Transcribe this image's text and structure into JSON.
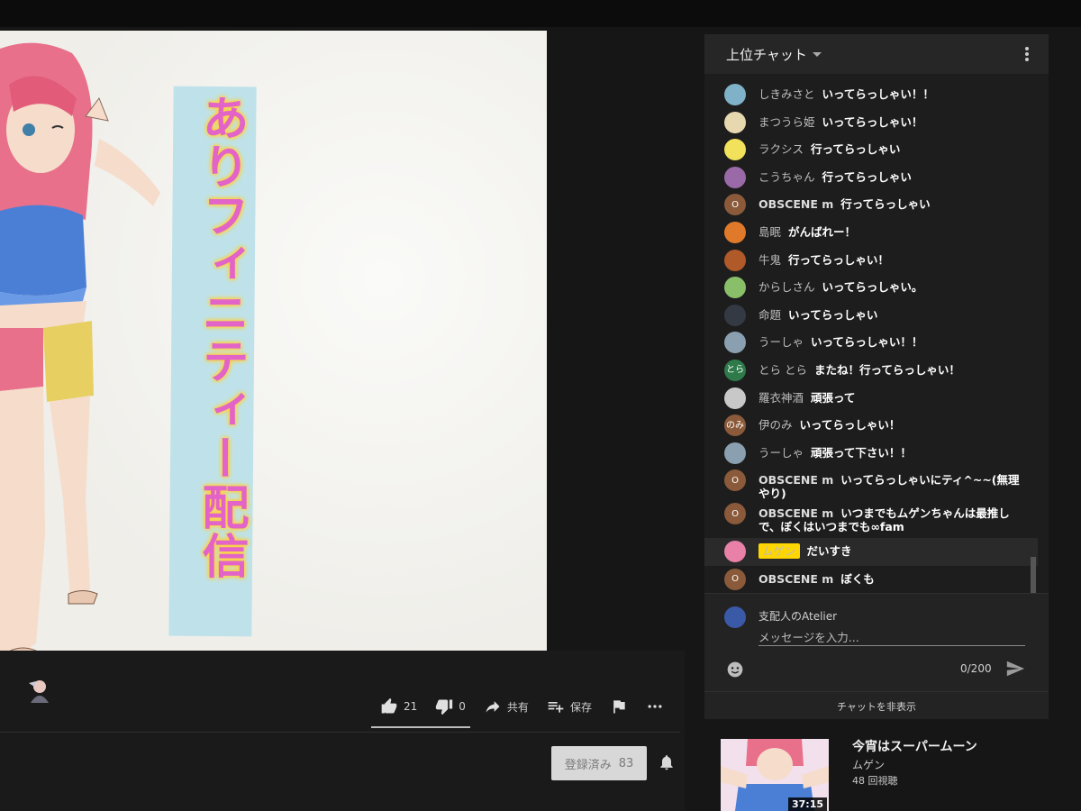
{
  "video": {
    "banner_text": "ありフィニティー配信"
  },
  "actions": {
    "like_count": "21",
    "dislike_count": "0",
    "share_label": "共有",
    "save_label": "保存"
  },
  "subscribe": {
    "label": "登録済み",
    "count": "83"
  },
  "chat": {
    "header_title": "上位チャット",
    "messages": [
      {
        "author": "しきみさと",
        "text": "いってらっしゃい！！",
        "avatar_color": "#7fb2c8",
        "avatar_text": ""
      },
      {
        "author": "まつうら姫",
        "text": "いってらっしゃい！",
        "avatar_color": "#e8d8b0",
        "avatar_text": ""
      },
      {
        "author": "ラクシス",
        "text": "行ってらっしゃい",
        "avatar_color": "#f2e15a",
        "avatar_text": ""
      },
      {
        "author": "こうちゃん",
        "text": "行ってらっしゃい",
        "avatar_color": "#9a6aa8",
        "avatar_text": ""
      },
      {
        "author": "OBSCENE m",
        "text": "行ってらっしゃい",
        "avatar_color": "#8a5a3a",
        "avatar_text": "O"
      },
      {
        "author": "島眠",
        "text": "がんばれー！",
        "avatar_color": "#e07a2a",
        "avatar_text": ""
      },
      {
        "author": "牛鬼",
        "text": "行ってらっしゃい！",
        "avatar_color": "#b05a2a",
        "avatar_text": ""
      },
      {
        "author": "からしさん",
        "text": "いってらっしゃい。",
        "avatar_color": "#8abf6a",
        "avatar_text": ""
      },
      {
        "author": "命題",
        "text": "いってらっしゃい",
        "avatar_color": "#333a44",
        "avatar_text": ""
      },
      {
        "author": "うーしゃ",
        "text": "いってらっしゃい！！",
        "avatar_color": "#8aa0b0",
        "avatar_text": ""
      },
      {
        "author": "とら とら",
        "text": "またね！行ってらっしゃい！",
        "avatar_color": "#2e7a4a",
        "avatar_text": "とら"
      },
      {
        "author": "羅衣神酒",
        "text": "頑張って",
        "avatar_color": "#c8c8c8",
        "avatar_text": ""
      },
      {
        "author": "伊のみ",
        "text": "いってらっしゃい！",
        "avatar_color": "#8a5a3a",
        "avatar_text": "のみ"
      },
      {
        "author": "うーしゃ",
        "text": "頑張って下さい！！",
        "avatar_color": "#8aa0b0",
        "avatar_text": ""
      },
      {
        "author": "OBSCENE m",
        "text": "いってらっしゃいにティ^~~(無理やり)",
        "avatar_color": "#8a5a3a",
        "avatar_text": "O"
      },
      {
        "author": "OBSCENE m",
        "text": "いつまでもムゲンちゃんは最推しで、ぼくはいつまでも∞fam",
        "avatar_color": "#8a5a3a",
        "avatar_text": "O"
      },
      {
        "author": "ムゲン",
        "text": "だいすき",
        "avatar_color": "#e880a8",
        "avatar_text": ""
      },
      {
        "author": "OBSCENE m",
        "text": "ぼくも",
        "avatar_color": "#8a5a3a",
        "avatar_text": "O"
      }
    ],
    "composer": {
      "user_name": "支配人のAtelier",
      "placeholder": "メッセージを入力...",
      "counter": "0/200",
      "hide_label": "チャットを非表示"
    }
  },
  "recommendation": {
    "title": "今宵はスーパームーン",
    "channel": "ムゲン",
    "views": "48 回視聴",
    "duration": "37:15"
  }
}
